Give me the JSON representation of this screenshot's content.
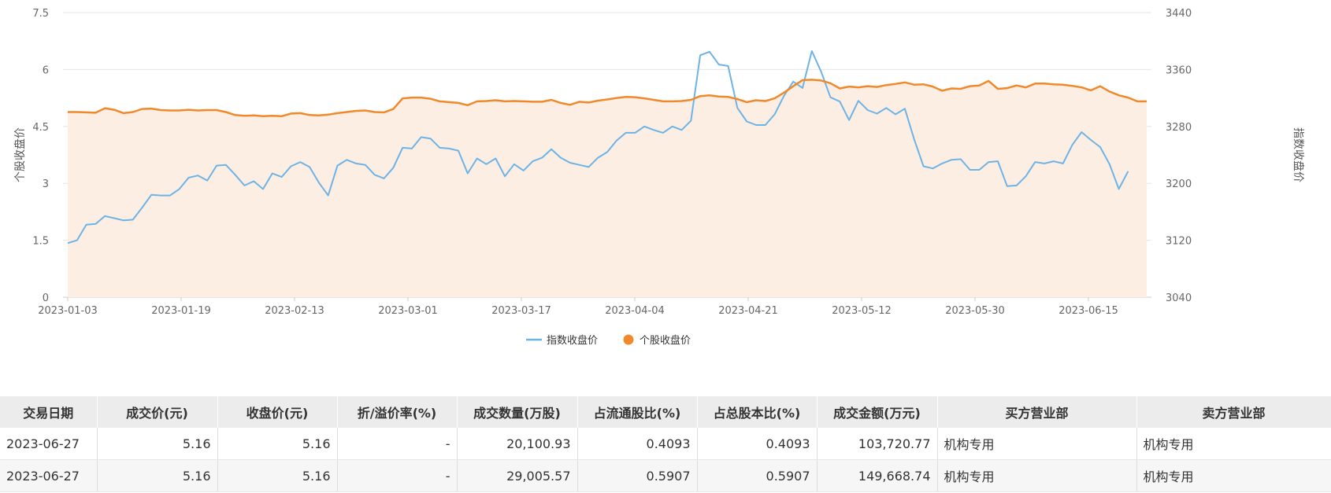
{
  "chart_data": {
    "type": "line",
    "x_tick_labels": [
      "2023-01-03",
      "2023-01-19",
      "2023-02-13",
      "2023-03-01",
      "2023-03-17",
      "2023-04-04",
      "2023-04-21",
      "2023-05-12",
      "2023-05-30",
      "2023-06-15"
    ],
    "y_left": {
      "label": "个股收盘价",
      "ticks": [
        "0",
        "1.5",
        "3",
        "4.5",
        "6",
        "7.5"
      ],
      "range": [
        0,
        7.5
      ]
    },
    "y_right": {
      "label": "指数收盘价",
      "ticks": [
        "3040",
        "3120",
        "3200",
        "3280",
        "3360",
        "3440"
      ],
      "range": [
        3040,
        3440
      ]
    },
    "grid": true,
    "legend_position": "bottom-center",
    "series": [
      {
        "name": "指数收盘价",
        "axis": "right",
        "color": "#6db3e6",
        "values": [
          3116,
          3120,
          3142,
          3143,
          3154,
          3151,
          3148,
          3149,
          3166,
          3184,
          3183,
          3183,
          3192,
          3208,
          3211,
          3204,
          3225,
          3226,
          3212,
          3197,
          3203,
          3192,
          3214,
          3209,
          3224,
          3230,
          3223,
          3201,
          3183,
          3225,
          3233,
          3228,
          3226,
          3212,
          3207,
          3222,
          3250,
          3249,
          3265,
          3263,
          3250,
          3249,
          3246,
          3214,
          3235,
          3227,
          3235,
          3210,
          3227,
          3218,
          3231,
          3236,
          3248,
          3236,
          3229,
          3226,
          3223,
          3236,
          3244,
          3260,
          3271,
          3271,
          3280,
          3275,
          3271,
          3280,
          3275,
          3288,
          3380,
          3385,
          3367,
          3365,
          3306,
          3287,
          3282,
          3282,
          3297,
          3323,
          3343,
          3334,
          3386,
          3357,
          3321,
          3315,
          3289,
          3316,
          3303,
          3298,
          3306,
          3297,
          3305,
          3262,
          3224,
          3221,
          3228,
          3233,
          3234,
          3219,
          3219,
          3230,
          3231,
          3196,
          3197,
          3210,
          3230,
          3228,
          3231,
          3228,
          3254,
          3272,
          3261,
          3251,
          3227,
          3192,
          3217
        ]
      },
      {
        "name": "个股收盘价",
        "axis": "left",
        "color": "#f0892b",
        "fill": "#fdeee3",
        "values": [
          4.88,
          4.88,
          4.87,
          4.86,
          4.98,
          4.94,
          4.85,
          4.88,
          4.96,
          4.97,
          4.93,
          4.92,
          4.92,
          4.94,
          4.92,
          4.93,
          4.93,
          4.88,
          4.8,
          4.78,
          4.79,
          4.77,
          4.78,
          4.77,
          4.84,
          4.85,
          4.8,
          4.79,
          4.81,
          4.85,
          4.88,
          4.91,
          4.92,
          4.88,
          4.87,
          4.96,
          5.24,
          5.26,
          5.26,
          5.23,
          5.16,
          5.14,
          5.12,
          5.06,
          5.16,
          5.17,
          5.19,
          5.16,
          5.17,
          5.16,
          5.15,
          5.15,
          5.2,
          5.12,
          5.07,
          5.15,
          5.13,
          5.18,
          5.21,
          5.25,
          5.28,
          5.27,
          5.24,
          5.2,
          5.16,
          5.16,
          5.17,
          5.2,
          5.3,
          5.32,
          5.29,
          5.28,
          5.22,
          5.14,
          5.19,
          5.17,
          5.24,
          5.39,
          5.56,
          5.72,
          5.73,
          5.71,
          5.64,
          5.5,
          5.55,
          5.53,
          5.56,
          5.54,
          5.59,
          5.62,
          5.66,
          5.6,
          5.61,
          5.55,
          5.44,
          5.5,
          5.49,
          5.56,
          5.58,
          5.7,
          5.49,
          5.51,
          5.58,
          5.53,
          5.63,
          5.63,
          5.61,
          5.6,
          5.57,
          5.53,
          5.45,
          5.56,
          5.42,
          5.32,
          5.26,
          5.16,
          5.16
        ]
      }
    ]
  },
  "table": {
    "headers": [
      "交易日期",
      "成交价(元)",
      "收盘价(元)",
      "折/溢价率(%)",
      "成交数量(万股)",
      "占流通股比(%)",
      "占总股本比(%)",
      "成交金额(万元)",
      "买方营业部",
      "卖方营业部"
    ],
    "rows": [
      [
        "2023-06-27",
        "5.16",
        "5.16",
        "-",
        "20,100.93",
        "0.4093",
        "0.4093",
        "103,720.77",
        "机构专用",
        "机构专用"
      ],
      [
        "2023-06-27",
        "5.16",
        "5.16",
        "-",
        "29,005.57",
        "0.5907",
        "0.5907",
        "149,668.74",
        "机构专用",
        "机构专用"
      ]
    ]
  }
}
